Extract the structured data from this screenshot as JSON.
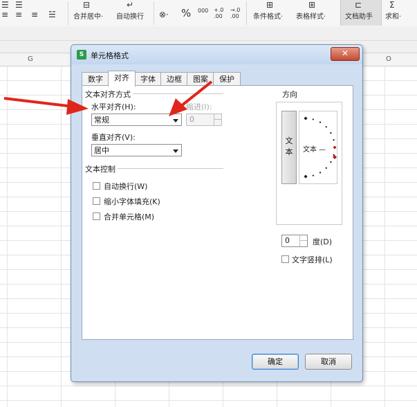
{
  "ribbon": {
    "merge_center": "合并居中",
    "auto_wrap": "自动换行",
    "percent_symbol": "%",
    "thousands_symbol": "000",
    "dec_increase": "+.0 .00",
    "dec_decrease": "→.0 .00",
    "conditional_format": "条件格式",
    "table_style": "表格样式",
    "doc_assistant": "文档助手",
    "sum": "求和"
  },
  "sheet": {
    "col_g": "G",
    "col_o": "O"
  },
  "dialog": {
    "title": "单元格格式",
    "app_icon_letter": "S",
    "close_symbol": "✕",
    "tabs": [
      "数字",
      "对齐",
      "字体",
      "边框",
      "图案",
      "保护"
    ],
    "active_tab": "对齐",
    "text_alignment": {
      "group_title": "文本对齐方式",
      "horizontal_label": "水平对齐(H):",
      "horizontal_value": "常规",
      "indent_label": "缩进(I):",
      "indent_value": "0",
      "vertical_label": "垂直对齐(V):",
      "vertical_value": "居中"
    },
    "text_control": {
      "group_title": "文本控制",
      "options": [
        "自动换行(W)",
        "缩小字体填充(K)",
        "合并单元格(M)"
      ]
    },
    "orientation": {
      "group_title": "方向",
      "vertical_text": [
        "文",
        "本"
      ],
      "dial_text": "文本 —",
      "degree_value": "0",
      "degree_label": "度(D)",
      "vertical_layout_label": "文字竖排(L)"
    },
    "ok_label": "确定",
    "cancel_label": "取消"
  },
  "colors": {
    "annotation_arrow": "#e0261b",
    "dialog_frame": "#cfdff1",
    "close_button": "#c34a31",
    "app_icon": "#2b9c4a"
  }
}
